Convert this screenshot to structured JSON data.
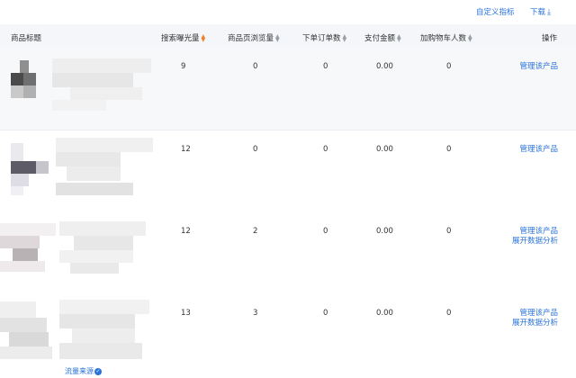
{
  "toolbar": {
    "custom_metrics": "自定义指标",
    "download": "下载"
  },
  "columns": {
    "product_title": "商品标题",
    "search_exposure": "搜索曝光量",
    "product_page_views": "商品页浏览量",
    "order_count": "下单订单数",
    "payment_amount": "支付金额",
    "add_to_cart_users": "加购物车人数",
    "actions": "操作"
  },
  "rows": [
    {
      "search_exposure": "9",
      "product_page_views": "0",
      "order_count": "0",
      "payment_amount": "0.00",
      "add_to_cart_users": "0",
      "actions": [
        "管理该产品"
      ]
    },
    {
      "search_exposure": "12",
      "product_page_views": "0",
      "order_count": "0",
      "payment_amount": "0.00",
      "add_to_cart_users": "0",
      "actions": [
        "管理该产品"
      ]
    },
    {
      "search_exposure": "12",
      "product_page_views": "2",
      "order_count": "0",
      "payment_amount": "0.00",
      "add_to_cart_users": "0",
      "actions": [
        "管理该产品",
        "展开数据分析"
      ]
    },
    {
      "search_exposure": "13",
      "product_page_views": "3",
      "order_count": "0",
      "payment_amount": "0.00",
      "add_to_cart_users": "0",
      "actions": [
        "管理该产品",
        "展开数据分析"
      ]
    }
  ],
  "traffic_source": "流量来源",
  "colors": {
    "link": "#2a73d9",
    "active_sort": "#f07f2a",
    "header_bg": "#f4f6f9"
  },
  "icons": {
    "download": "download-icon",
    "sort": "sort-icon",
    "check": "check-icon"
  }
}
